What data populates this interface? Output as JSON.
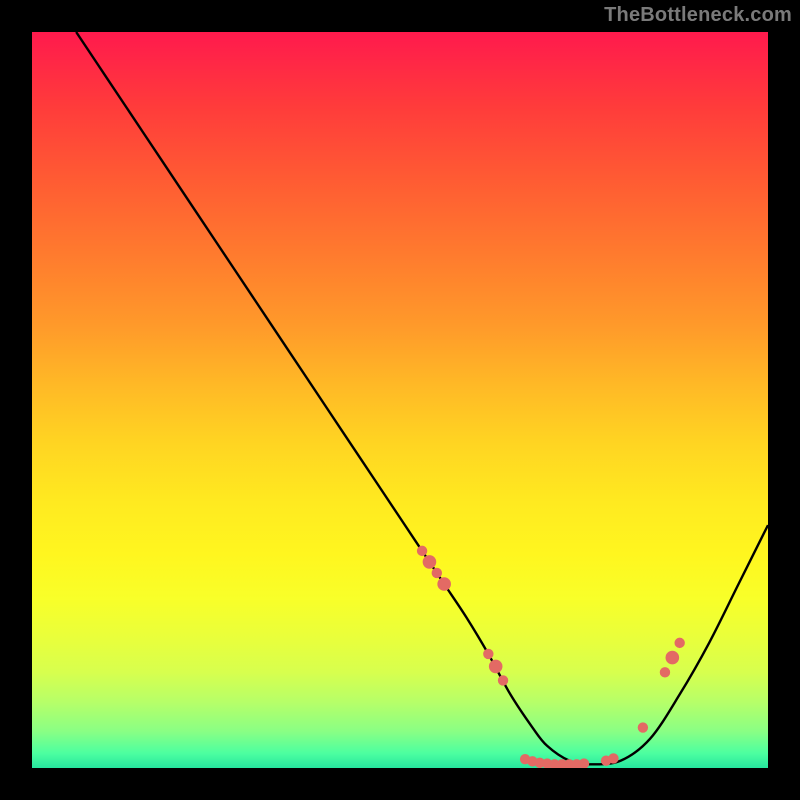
{
  "watermark": "TheBottleneck.com",
  "chart_data": {
    "type": "line",
    "title": "",
    "xlabel": "",
    "ylabel": "",
    "xlim": [
      0,
      100
    ],
    "ylim": [
      0,
      100
    ],
    "curve": {
      "name": "bottleneck-curve",
      "x": [
        6,
        10,
        15,
        20,
        25,
        30,
        35,
        40,
        45,
        50,
        53,
        56,
        59,
        62,
        65,
        68,
        70,
        73,
        76,
        80,
        84,
        88,
        92,
        96,
        100
      ],
      "y": [
        100,
        94,
        86.5,
        79,
        71.5,
        64,
        56.5,
        49,
        41.5,
        34,
        29.5,
        25,
        20.5,
        15.5,
        10,
        5.5,
        3,
        1,
        0.5,
        1,
        4,
        10,
        17,
        25,
        33
      ]
    },
    "markers": {
      "name": "bottleneck-markers",
      "color_left": "#e86a66",
      "color_min": "#e36a64",
      "color_right": "#e86a66",
      "points": [
        {
          "x": 53,
          "y": 29.5,
          "r_small": true
        },
        {
          "x": 54,
          "y": 28.0,
          "r_small": false
        },
        {
          "x": 55,
          "y": 26.5,
          "r_small": true
        },
        {
          "x": 56,
          "y": 25.0,
          "r_small": false
        },
        {
          "x": 62,
          "y": 15.5,
          "r_small": true
        },
        {
          "x": 63,
          "y": 13.8,
          "r_small": false
        },
        {
          "x": 64,
          "y": 11.9,
          "r_small": true
        },
        {
          "x": 67,
          "y": 1.2,
          "r_small": true
        },
        {
          "x": 68,
          "y": 0.9,
          "r_small": true
        },
        {
          "x": 69,
          "y": 0.7,
          "r_small": true
        },
        {
          "x": 70,
          "y": 0.6,
          "r_small": true
        },
        {
          "x": 71,
          "y": 0.5,
          "r_small": true
        },
        {
          "x": 72,
          "y": 0.5,
          "r_small": true
        },
        {
          "x": 73,
          "y": 0.5,
          "r_small": true
        },
        {
          "x": 74,
          "y": 0.5,
          "r_small": true
        },
        {
          "x": 75,
          "y": 0.6,
          "r_small": true
        },
        {
          "x": 78,
          "y": 1.0,
          "r_small": true
        },
        {
          "x": 79,
          "y": 1.3,
          "r_small": true
        },
        {
          "x": 83,
          "y": 5.5,
          "r_small": true
        },
        {
          "x": 86,
          "y": 13.0,
          "r_small": true
        },
        {
          "x": 87,
          "y": 15.0,
          "r_small": false
        },
        {
          "x": 88,
          "y": 17.0,
          "r_small": true
        }
      ]
    }
  }
}
